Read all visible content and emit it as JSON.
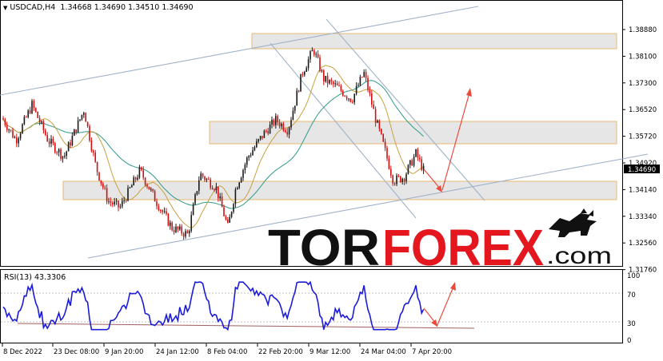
{
  "header": {
    "symbol": "USDCAD,H4",
    "ohlc": "1.34668 1.34690 1.34510 1.34690"
  },
  "rsi": {
    "label": "RSI(13) 43.3306",
    "levels": [
      "100",
      "70",
      "30",
      "0"
    ]
  },
  "price_axis": {
    "ticks": [
      "1.38880",
      "1.38100",
      "1.37300",
      "1.36520",
      "1.35720",
      "1.34920",
      "1.34140",
      "1.33340",
      "1.32560",
      "1.31760"
    ],
    "current_price": "1.34690"
  },
  "time_axis": {
    "ticks": [
      "8 Dec 2022",
      "23 Dec 08:00",
      "9 Jan 20:00",
      "24 Jan 12:00",
      "8 Feb 04:00",
      "22 Feb 20:00",
      "9 Mar 12:00",
      "24 Mar 04:00",
      "7 Apr 20:00"
    ]
  },
  "watermark": {
    "part1": "TOR",
    "part2": "FOREX",
    "part3": ".com"
  },
  "colors": {
    "bull_candle": "#1a1a1a",
    "bear_candle": "#d01010",
    "ma_slow": "#2f9a8a",
    "ma_fast": "#c8a040",
    "channel_line": "#9fb2c8",
    "zone_fill": "#e6e6e6",
    "zone_border": "#e8b870",
    "arrow": "#ea4a3c",
    "rsi_line": "#1c1cd8",
    "rsi_trend": "#a06060",
    "watermark_red": "#e4161e"
  },
  "chart_data": {
    "type": "candlestick",
    "symbol": "USDCAD",
    "timeframe": "H4",
    "close_path": {
      "x": [
        "8 Dec 2022",
        "23 Dec 08:00",
        "9 Jan 20:00",
        "24 Jan 12:00",
        "8 Feb 04:00",
        "22 Feb 20:00",
        "9 Mar 12:00",
        "24 Mar 04:00",
        "7 Apr 20:00"
      ],
      "y": [
        1.3625,
        1.36,
        1.338,
        1.336,
        1.339,
        1.355,
        1.381,
        1.367,
        1.348
      ]
    },
    "ylim": [
      1.3176,
      1.3888
    ],
    "support_zones": [
      [
        1.3385,
        1.3437
      ],
      [
        1.3535,
        1.3615
      ],
      [
        1.3845,
        1.3895
      ]
    ],
    "rsi": {
      "period": 13,
      "last": 43.3306,
      "levels": [
        30,
        70
      ],
      "ylim": [
        0,
        100
      ]
    }
  }
}
